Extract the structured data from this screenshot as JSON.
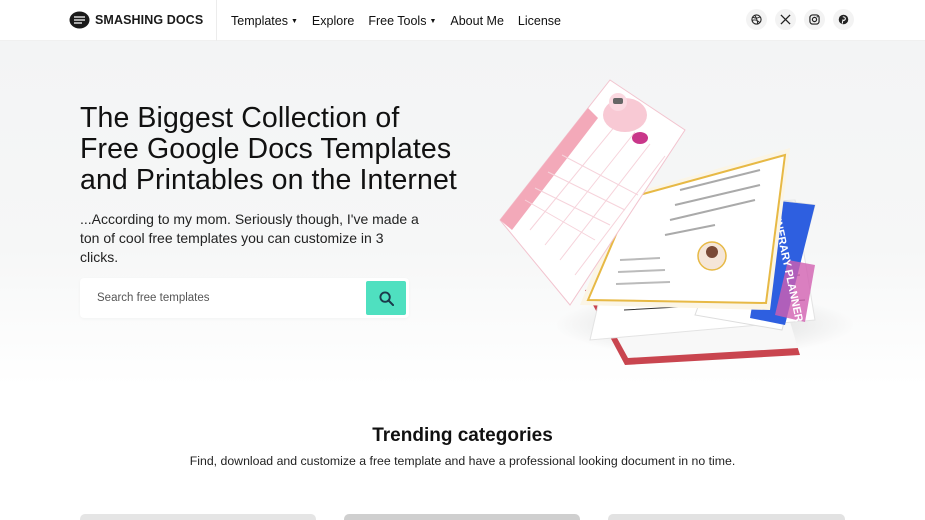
{
  "header": {
    "brand": "SMASHING DOCS",
    "nav": [
      {
        "label": "Templates",
        "dropdown": true
      },
      {
        "label": "Explore",
        "dropdown": false
      },
      {
        "label": "Free Tools",
        "dropdown": true
      },
      {
        "label": "About Me",
        "dropdown": false
      },
      {
        "label": "License",
        "dropdown": false
      }
    ],
    "socials": [
      "dribbble-icon",
      "x-twitter-icon",
      "instagram-icon",
      "pinterest-icon"
    ]
  },
  "hero": {
    "title_line1": "The Biggest Collection of",
    "title_line2": "Free Google Docs Templates",
    "title_line3": "and Printables on the Internet",
    "subtitle": "...According to my mom. Seriously though, I've made a ton of cool free templates you can customize in 3 clicks.",
    "search": {
      "placeholder": "Search free templates",
      "button_icon": "search-icon",
      "button_color": "#4fe0c0"
    },
    "illustration": {
      "front_label": "ITINERARY PLANNER",
      "accent_colors": [
        "#f8c9d4",
        "#e7b945",
        "#2e5fe0"
      ]
    }
  },
  "trending": {
    "title": "Trending categories",
    "subtitle": "Find, download and customize a free template and have a professional looking document in no time."
  },
  "colors": {
    "accent": "#4fe0c0",
    "hero_bg": "#f3f4f5",
    "text": "#111111"
  }
}
